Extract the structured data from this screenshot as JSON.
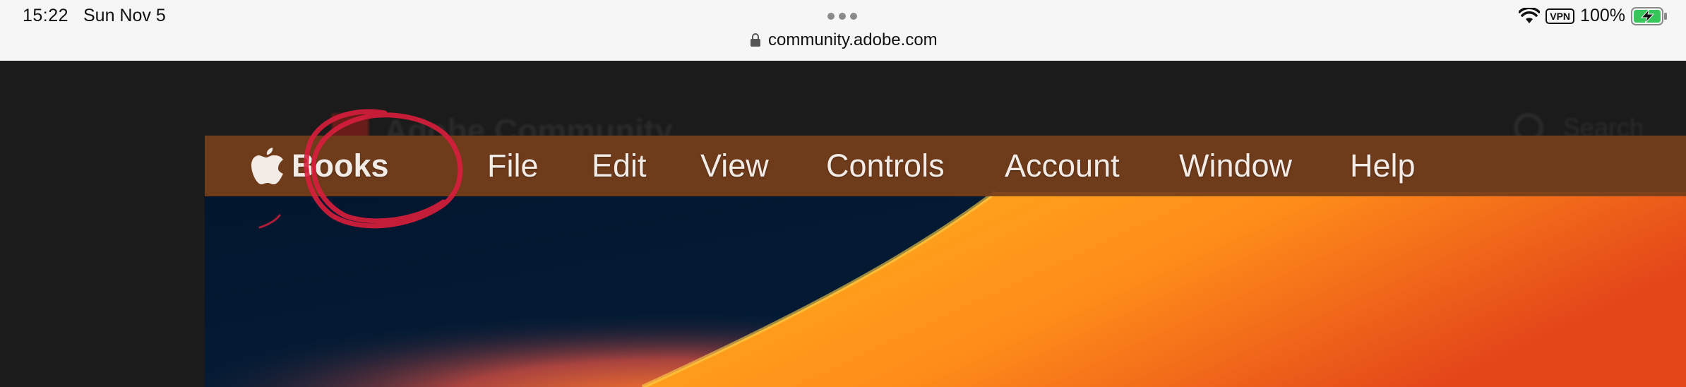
{
  "status_bar": {
    "time": "15:22",
    "date": "Sun Nov 5",
    "url": "community.adobe.com",
    "vpn": "VPN",
    "battery": "100%",
    "battery_level": 1.0
  },
  "background_page": {
    "brand": "Adobe Community",
    "search_hint": "Search"
  },
  "menubar": {
    "items": [
      {
        "label": "Books",
        "bold": true
      },
      {
        "label": "File"
      },
      {
        "label": "Edit"
      },
      {
        "label": "View"
      },
      {
        "label": "Controls"
      },
      {
        "label": "Account"
      },
      {
        "label": "Window"
      },
      {
        "label": "Help"
      }
    ]
  },
  "colors": {
    "menubar": "#763e1a",
    "annotation": "#d81e3c",
    "wallpaper_navy": "#031b34",
    "wallpaper_orange": "#ff8a1c",
    "battery_green": "#35c759"
  }
}
